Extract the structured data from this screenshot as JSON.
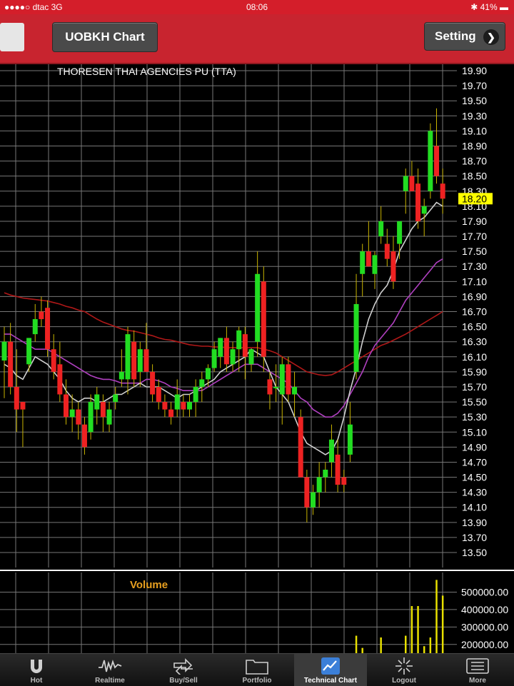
{
  "status_bar": {
    "carrier": "●●●●○ dtac  3G",
    "time": "08:06",
    "battery": "41%"
  },
  "nav": {
    "title": "UOBKH Chart",
    "setting": "Setting"
  },
  "chart": {
    "stock_name": "THORESEN THAI AGENCIES PU (TTA)",
    "price_axis": [
      "19.90",
      "19.70",
      "19.50",
      "19.30",
      "19.10",
      "18.90",
      "18.70",
      "18.50",
      "18.30",
      "18.10",
      "17.90",
      "17.70",
      "17.50",
      "17.30",
      "17.10",
      "16.90",
      "16.70",
      "16.50",
      "16.30",
      "16.10",
      "15.90",
      "15.70",
      "15.50",
      "15.30",
      "15.10",
      "14.90",
      "14.70",
      "14.50",
      "14.30",
      "14.10",
      "13.90",
      "13.70",
      "13.50"
    ],
    "last_price_label": "18.20",
    "volume_title": "Volume",
    "volume_axis": [
      "500000.00",
      "400000.00",
      "300000.00",
      "200000.00"
    ],
    "colors": {
      "up": "#22dd22",
      "down": "#ee2222",
      "ma_white": "#cfcfcf",
      "ma_purple": "#b040c0",
      "ma_red": "#b01818",
      "grid": "#777777",
      "volume": "#e8e000",
      "highlight": "#ffff00"
    }
  },
  "chart_data": {
    "type": "candlestick",
    "title": "THORESEN THAI AGENCIES PU (TTA)",
    "ylim": [
      13.5,
      19.9
    ],
    "candles": [
      {
        "o": 16.05,
        "h": 16.5,
        "l": 15.55,
        "c": 16.3
      },
      {
        "o": 16.3,
        "h": 16.55,
        "l": 15.6,
        "c": 15.7
      },
      {
        "o": 15.7,
        "h": 16.2,
        "l": 15.1,
        "c": 15.4
      },
      {
        "o": 15.5,
        "h": 15.5,
        "l": 14.9,
        "c": 15.4
      },
      {
        "o": 16.0,
        "h": 16.35,
        "l": 15.9,
        "c": 16.35
      },
      {
        "o": 16.4,
        "h": 16.8,
        "l": 16.3,
        "c": 16.6
      },
      {
        "o": 16.7,
        "h": 16.9,
        "l": 16.5,
        "c": 16.6
      },
      {
        "o": 16.75,
        "h": 16.85,
        "l": 16.1,
        "c": 16.2
      },
      {
        "o": 16.2,
        "h": 16.4,
        "l": 15.8,
        "c": 15.9
      },
      {
        "o": 16.0,
        "h": 16.3,
        "l": 15.5,
        "c": 15.6
      },
      {
        "o": 15.6,
        "h": 15.8,
        "l": 15.2,
        "c": 15.3
      },
      {
        "o": 15.3,
        "h": 15.6,
        "l": 15.1,
        "c": 15.4
      },
      {
        "o": 15.4,
        "h": 15.5,
        "l": 15.0,
        "c": 15.2
      },
      {
        "o": 15.2,
        "h": 15.3,
        "l": 14.8,
        "c": 14.9
      },
      {
        "o": 15.1,
        "h": 15.6,
        "l": 15.0,
        "c": 15.5
      },
      {
        "o": 15.4,
        "h": 15.7,
        "l": 15.2,
        "c": 15.6
      },
      {
        "o": 15.5,
        "h": 15.6,
        "l": 15.1,
        "c": 15.3
      },
      {
        "o": 15.2,
        "h": 15.5,
        "l": 15.1,
        "c": 15.4
      },
      {
        "o": 15.5,
        "h": 15.7,
        "l": 15.4,
        "c": 15.6
      },
      {
        "o": 15.8,
        "h": 16.2,
        "l": 15.7,
        "c": 15.9
      },
      {
        "o": 15.8,
        "h": 16.5,
        "l": 15.6,
        "c": 16.4
      },
      {
        "o": 16.3,
        "h": 16.45,
        "l": 15.7,
        "c": 15.8
      },
      {
        "o": 15.9,
        "h": 16.3,
        "l": 15.7,
        "c": 16.2
      },
      {
        "o": 16.2,
        "h": 16.55,
        "l": 15.9,
        "c": 15.9
      },
      {
        "o": 15.9,
        "h": 16.0,
        "l": 15.5,
        "c": 15.6
      },
      {
        "o": 15.7,
        "h": 15.8,
        "l": 15.4,
        "c": 15.5
      },
      {
        "o": 15.5,
        "h": 15.6,
        "l": 15.3,
        "c": 15.4
      },
      {
        "o": 15.4,
        "h": 15.5,
        "l": 15.2,
        "c": 15.3
      },
      {
        "o": 15.4,
        "h": 15.8,
        "l": 15.3,
        "c": 15.6
      },
      {
        "o": 15.5,
        "h": 15.6,
        "l": 15.3,
        "c": 15.4
      },
      {
        "o": 15.4,
        "h": 15.6,
        "l": 15.3,
        "c": 15.5
      },
      {
        "o": 15.5,
        "h": 15.8,
        "l": 15.3,
        "c": 15.7
      },
      {
        "o": 15.7,
        "h": 15.9,
        "l": 15.5,
        "c": 15.8
      },
      {
        "o": 15.8,
        "h": 16.0,
        "l": 15.7,
        "c": 15.95
      },
      {
        "o": 15.95,
        "h": 16.3,
        "l": 15.9,
        "c": 16.2
      },
      {
        "o": 16.1,
        "h": 16.35,
        "l": 15.95,
        "c": 16.35
      },
      {
        "o": 16.35,
        "h": 16.5,
        "l": 15.9,
        "c": 16.0
      },
      {
        "o": 16.0,
        "h": 16.3,
        "l": 15.9,
        "c": 16.2
      },
      {
        "o": 16.2,
        "h": 16.5,
        "l": 15.9,
        "c": 16.45
      },
      {
        "o": 16.4,
        "h": 16.5,
        "l": 15.8,
        "c": 16.1
      },
      {
        "o": 16.0,
        "h": 16.2,
        "l": 15.9,
        "c": 16.2
      },
      {
        "o": 16.3,
        "h": 17.5,
        "l": 16.1,
        "c": 17.2
      },
      {
        "o": 17.1,
        "h": 17.3,
        "l": 15.9,
        "c": 16.1
      },
      {
        "o": 15.8,
        "h": 15.9,
        "l": 15.4,
        "c": 15.6
      },
      {
        "o": 15.7,
        "h": 16.0,
        "l": 15.5,
        "c": 15.7
      },
      {
        "o": 15.6,
        "h": 16.1,
        "l": 15.2,
        "c": 16.0
      },
      {
        "o": 16.0,
        "h": 16.1,
        "l": 15.5,
        "c": 15.6
      },
      {
        "o": 15.6,
        "h": 15.9,
        "l": 15.3,
        "c": 15.7
      },
      {
        "o": 15.3,
        "h": 15.4,
        "l": 14.8,
        "c": 14.5
      },
      {
        "o": 14.5,
        "h": 14.6,
        "l": 13.9,
        "c": 14.1
      },
      {
        "o": 14.1,
        "h": 14.4,
        "l": 14.0,
        "c": 14.3
      },
      {
        "o": 14.3,
        "h": 14.7,
        "l": 14.1,
        "c": 14.5
      },
      {
        "o": 14.5,
        "h": 14.7,
        "l": 14.3,
        "c": 14.6
      },
      {
        "o": 14.7,
        "h": 15.2,
        "l": 14.5,
        "c": 15.0
      },
      {
        "o": 14.8,
        "h": 15.0,
        "l": 14.3,
        "c": 14.4
      },
      {
        "o": 14.5,
        "h": 14.6,
        "l": 14.3,
        "c": 14.4
      },
      {
        "o": 14.8,
        "h": 15.5,
        "l": 14.7,
        "c": 15.2
      },
      {
        "o": 15.9,
        "h": 17.2,
        "l": 15.8,
        "c": 16.8
      },
      {
        "o": 17.2,
        "h": 17.6,
        "l": 16.9,
        "c": 17.5
      },
      {
        "o": 17.5,
        "h": 17.9,
        "l": 17.3,
        "c": 17.3
      },
      {
        "o": 17.2,
        "h": 17.5,
        "l": 17.0,
        "c": 17.45
      },
      {
        "o": 17.7,
        "h": 18.1,
        "l": 17.6,
        "c": 17.9
      },
      {
        "o": 17.6,
        "h": 17.8,
        "l": 17.3,
        "c": 17.4
      },
      {
        "o": 17.5,
        "h": 17.7,
        "l": 17.0,
        "c": 17.1
      },
      {
        "o": 17.6,
        "h": 17.9,
        "l": 17.4,
        "c": 17.9
      },
      {
        "o": 18.3,
        "h": 18.6,
        "l": 18.0,
        "c": 18.5
      },
      {
        "o": 18.5,
        "h": 18.7,
        "l": 18.3,
        "c": 18.3
      },
      {
        "o": 18.4,
        "h": 18.6,
        "l": 17.8,
        "c": 17.9
      },
      {
        "o": 18.0,
        "h": 18.2,
        "l": 17.7,
        "c": 18.1
      },
      {
        "o": 18.3,
        "h": 19.2,
        "l": 18.2,
        "c": 19.1
      },
      {
        "o": 18.9,
        "h": 19.4,
        "l": 18.4,
        "c": 18.5
      },
      {
        "o": 18.4,
        "h": 18.6,
        "l": 18.0,
        "c": 18.2
      }
    ],
    "ma_white": [
      16.0,
      15.95,
      15.85,
      15.8,
      15.95,
      16.1,
      16.05,
      16.0,
      15.9,
      15.8,
      15.65,
      15.55,
      15.5,
      15.55,
      15.55,
      15.5,
      15.5,
      15.55,
      15.6,
      15.6,
      15.65,
      15.7,
      15.75,
      15.7,
      15.7,
      15.7,
      15.65,
      15.6,
      15.55,
      15.6,
      15.6,
      15.65,
      15.7,
      15.75,
      15.8,
      15.9,
      15.95,
      16.0,
      16.05,
      16.1,
      16.2,
      16.15,
      16.1,
      15.9,
      15.7,
      15.6,
      15.5,
      15.3,
      15.1,
      14.95,
      14.9,
      14.85,
      14.8,
      14.85,
      15.0,
      15.3,
      15.65,
      15.95,
      16.3,
      16.6,
      16.8,
      16.95,
      17.05,
      17.25,
      17.5,
      17.65,
      17.8,
      17.9,
      17.95,
      18.05,
      18.15,
      18.1
    ],
    "ma_purple": [
      16.4,
      16.4,
      16.35,
      16.3,
      16.25,
      16.2,
      16.2,
      16.2,
      16.15,
      16.1,
      16.05,
      16.0,
      15.95,
      15.9,
      15.85,
      15.82,
      15.8,
      15.8,
      15.78,
      15.75,
      15.75,
      15.75,
      15.75,
      15.8,
      15.8,
      15.78,
      15.75,
      15.7,
      15.68,
      15.65,
      15.65,
      15.65,
      15.65,
      15.7,
      15.75,
      15.8,
      15.85,
      15.9,
      15.95,
      16.0,
      16.0,
      16.0,
      15.95,
      15.9,
      15.85,
      15.8,
      15.75,
      15.65,
      15.55,
      15.5,
      15.4,
      15.35,
      15.3,
      15.3,
      15.35,
      15.45,
      15.6,
      15.75,
      15.9,
      16.1,
      16.25,
      16.35,
      16.45,
      16.55,
      16.7,
      16.85,
      16.95,
      17.05,
      17.15,
      17.25,
      17.35,
      17.4
    ],
    "ma_red": [
      16.95,
      16.92,
      16.9,
      16.88,
      16.87,
      16.86,
      16.85,
      16.84,
      16.82,
      16.8,
      16.77,
      16.75,
      16.72,
      16.7,
      16.65,
      16.6,
      16.56,
      16.53,
      16.5,
      16.47,
      16.45,
      16.44,
      16.42,
      16.4,
      16.38,
      16.35,
      16.33,
      16.32,
      16.3,
      16.28,
      16.26,
      16.25,
      16.24,
      16.24,
      16.23,
      16.23,
      16.22,
      16.22,
      16.22,
      16.22,
      16.22,
      16.22,
      16.2,
      16.18,
      16.15,
      16.1,
      16.05,
      16.0,
      15.95,
      15.9,
      15.88,
      15.86,
      15.85,
      15.86,
      15.9,
      15.95,
      16.0,
      16.05,
      16.1,
      16.15,
      16.2,
      16.25,
      16.28,
      16.32,
      16.36,
      16.4,
      16.45,
      16.5,
      16.55,
      16.6,
      16.65,
      16.7
    ],
    "volume": [
      {
        "i": 41,
        "v": 150000
      },
      {
        "i": 56,
        "v": 120000
      },
      {
        "i": 57,
        "v": 250000
      },
      {
        "i": 58,
        "v": 180000
      },
      {
        "i": 59,
        "v": 110000
      },
      {
        "i": 61,
        "v": 240000
      },
      {
        "i": 65,
        "v": 250000
      },
      {
        "i": 66,
        "v": 420000
      },
      {
        "i": 67,
        "v": 420000
      },
      {
        "i": 68,
        "v": 190000
      },
      {
        "i": 69,
        "v": 240000
      },
      {
        "i": 70,
        "v": 570000
      },
      {
        "i": 71,
        "v": 480000
      }
    ],
    "volume_ylim": [
      150000,
      600000
    ]
  },
  "tabs": [
    {
      "label": "Hot",
      "icon": "hot-icon"
    },
    {
      "label": "Realtime",
      "icon": "realtime-icon"
    },
    {
      "label": "Buy/Sell",
      "icon": "buy-sell-icon"
    },
    {
      "label": "Portfolio",
      "icon": "portfolio-icon"
    },
    {
      "label": "Technical Chart",
      "icon": "technical-chart-icon"
    },
    {
      "label": "Logout",
      "icon": "logout-icon"
    },
    {
      "label": "More",
      "icon": "more-icon"
    }
  ],
  "active_tab": "Technical Chart"
}
